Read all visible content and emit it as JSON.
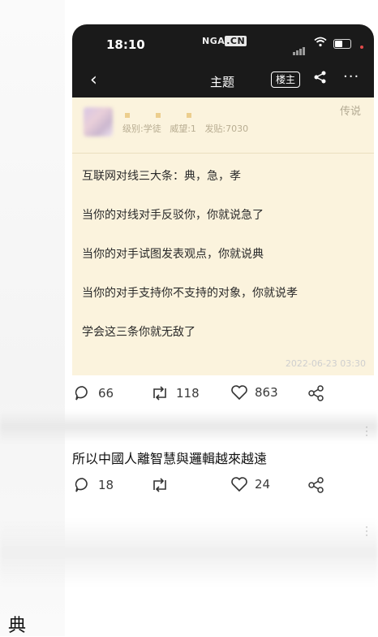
{
  "statusbar": {
    "time": "18:10",
    "brand_main": "NGA",
    "brand_cn": ".CN"
  },
  "navbar": {
    "back_label": "‹",
    "title": "主题",
    "op_badge": "楼主",
    "more_label": "···"
  },
  "user": {
    "level": "级别:学徒",
    "prestige": "威望:1",
    "posts": "发贴:7030",
    "legend_tag": "传说"
  },
  "post": {
    "lines": [
      "互联网对线三大条：典，急，孝",
      "当你的对线对手反驳你，你就说急了",
      "当你的对手试图发表观点，你就说典",
      "当你的对手支持你不支持的对象，你就说孝",
      "学会这三条你就无敌了"
    ],
    "timestamp": "2022-06-23 03:30"
  },
  "actions1": {
    "replies": "66",
    "reposts": "118",
    "likes": "863"
  },
  "comment": {
    "text": "所以中國人離智慧與邏輯越來越遠"
  },
  "actions2": {
    "replies": "18",
    "reposts": "",
    "likes": "24"
  },
  "footer": {
    "char": "典"
  },
  "colors": {
    "dark_bar": "#1a1a1a",
    "post_bg": "#fbf3dd",
    "meta_text": "#b8ad92"
  }
}
